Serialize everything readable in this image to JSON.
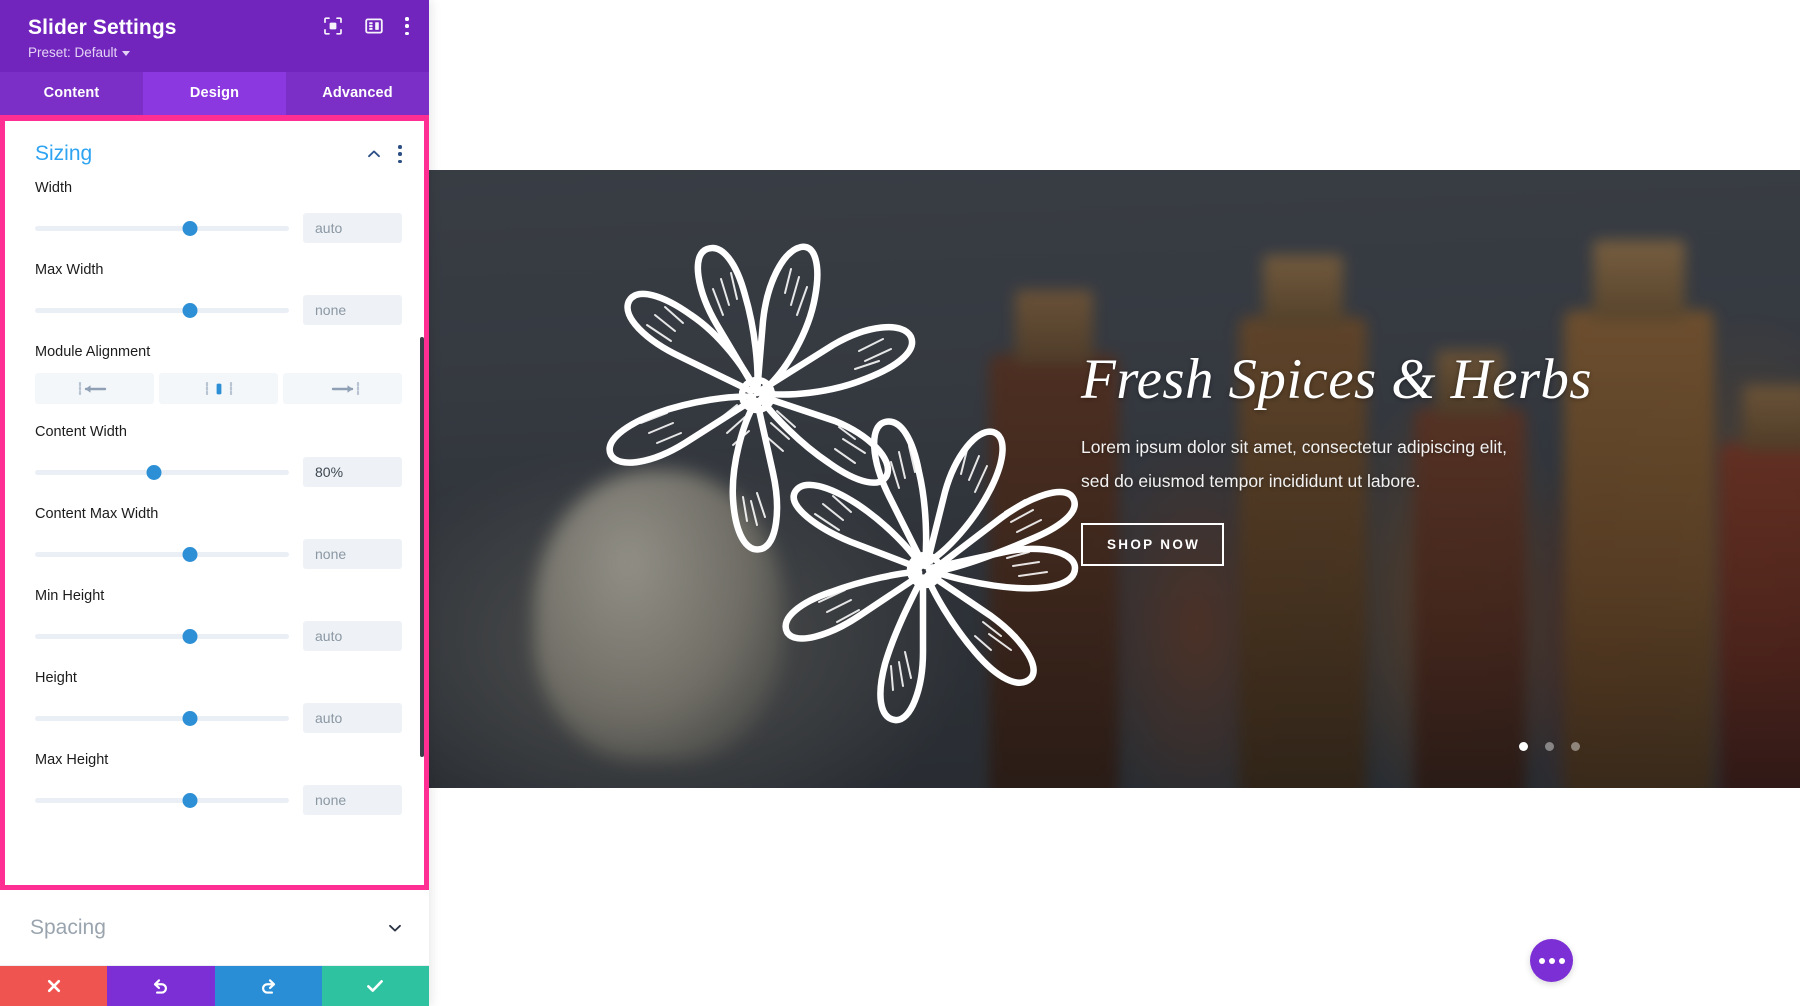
{
  "panel": {
    "title": "Slider Settings",
    "preset_label": "Preset: Default",
    "header_icons": [
      {
        "name": "focus-target-icon"
      },
      {
        "name": "layout-panel-icon"
      },
      {
        "name": "kebab-menu-icon"
      }
    ],
    "tabs": [
      {
        "label": "Content",
        "active": false
      },
      {
        "label": "Design",
        "active": true
      },
      {
        "label": "Advanced",
        "active": false
      }
    ],
    "sizing": {
      "title": "Sizing",
      "collapse_icon": "chevron-up-icon",
      "menu_icon": "kebab-menu-icon",
      "fields": [
        {
          "label": "Width",
          "value": "auto",
          "filled": false,
          "thumb_pct": 61
        },
        {
          "label": "Max Width",
          "value": "none",
          "filled": false,
          "thumb_pct": 61
        },
        {
          "label": "Content Width",
          "value": "80%",
          "filled": true,
          "thumb_pct": 47
        },
        {
          "label": "Content Max Width",
          "value": "none",
          "filled": false,
          "thumb_pct": 61
        },
        {
          "label": "Min Height",
          "value": "auto",
          "filled": false,
          "thumb_pct": 61
        },
        {
          "label": "Height",
          "value": "auto",
          "filled": false,
          "thumb_pct": 61
        },
        {
          "label": "Max Height",
          "value": "none",
          "filled": false,
          "thumb_pct": 61
        }
      ],
      "module_alignment": {
        "label": "Module Alignment",
        "options": [
          {
            "name": "align-left-button",
            "icon": "align-left-icon",
            "active": false
          },
          {
            "name": "align-center-button",
            "icon": "align-center-icon",
            "active": true
          },
          {
            "name": "align-right-button",
            "icon": "align-right-icon",
            "active": false
          }
        ]
      }
    },
    "spacing": {
      "title": "Spacing",
      "expand_icon": "chevron-down-icon"
    },
    "footer": {
      "buttons": [
        {
          "name": "cancel-button",
          "icon": "close-icon",
          "color": "#ef5451"
        },
        {
          "name": "undo-button",
          "icon": "undo-icon",
          "color": "#7b2fd4"
        },
        {
          "name": "redo-button",
          "icon": "redo-icon",
          "color": "#2a8ed6"
        },
        {
          "name": "save-button",
          "icon": "check-icon",
          "color": "#2ec2a0"
        }
      ]
    },
    "colors": {
      "header_purple": "#7225bd",
      "tab_active_purple": "#8c38e0",
      "highlight_pink": "#ff2e93",
      "section_blue": "#2ea3f2",
      "slider_thumb_blue": "#2d8fd5"
    }
  },
  "canvas": {
    "slide": {
      "heading": "Fresh Spices & Herbs",
      "paragraph_line1": "Lorem ipsum dolor sit amet, consectetur adipiscing elit,",
      "paragraph_line2": "sed do eiusmod tempor incididunt ut labore.",
      "button_label": "SHOP NOW",
      "dots": [
        {
          "active": true
        },
        {
          "active": false
        },
        {
          "active": false
        }
      ]
    },
    "fab": {
      "name": "page-settings-fab",
      "icon": "ellipsis-icon"
    }
  }
}
